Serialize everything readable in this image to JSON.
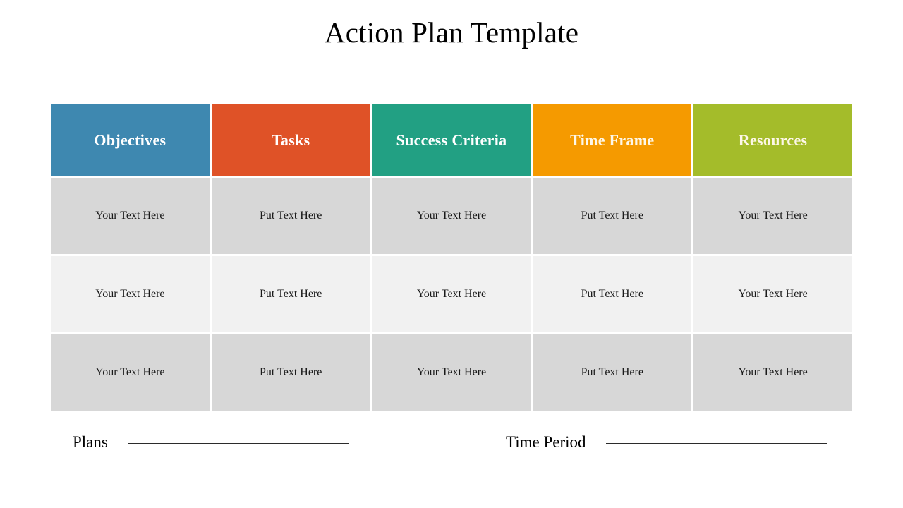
{
  "slide": {
    "title": "Action Plan Template",
    "background_color": "#ffffff"
  },
  "table": {
    "headers": [
      {
        "label": "Objectives",
        "color": "#3e88b0"
      },
      {
        "label": "Tasks",
        "color": "#df5227"
      },
      {
        "label": "Success Criteria",
        "color": "#22a083"
      },
      {
        "label": "Time Frame",
        "color": "#f59a00"
      },
      {
        "label": "Resources",
        "color": "#a4bc2a"
      }
    ],
    "row_colors": {
      "odd": "#d7d7d7",
      "even": "#f1f1f1"
    },
    "rows": [
      [
        "Your Text Here",
        "Put Text Here",
        "Your Text Here",
        "Put Text Here",
        "Your Text Here"
      ],
      [
        "Your Text Here",
        "Put Text Here",
        "Your Text Here",
        "Put Text Here",
        "Your Text Here"
      ],
      [
        "Your Text Here",
        "Put Text Here",
        "Your Text Here",
        "Put Text Here",
        "Your Text Here"
      ]
    ]
  },
  "footer": {
    "fields": [
      {
        "label": "Plans",
        "value": ""
      },
      {
        "label": "Time Period",
        "value": ""
      }
    ]
  }
}
